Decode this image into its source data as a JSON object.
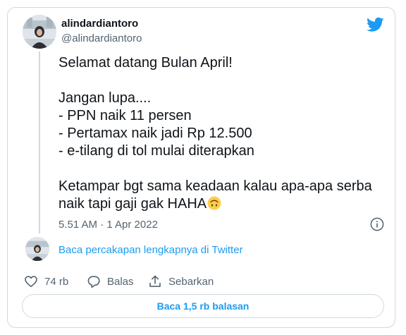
{
  "colors": {
    "accent": "#1d9bf0",
    "text_primary": "#0f1419",
    "text_secondary": "#536471",
    "border": "#cfd9de"
  },
  "tweet": {
    "display_name": "alindardiantoro",
    "handle": "@alindardiantoro",
    "text": "Selamat datang Bulan April!\n\nJangan lupa....\n- PPN naik 11 persen\n- Pertamax naik jadi Rp 12.500\n- e-tilang di tol mulai diterapkan\n\nKetampar bgt sama keadaan kalau apa-apa serba naik tapi gaji gak HAHA",
    "emoji": "upside-down-face-emoji",
    "timestamp": "5.51 AM · 1 Apr 2022",
    "icons": {
      "brand": "twitter-bird-icon",
      "info": "info-icon"
    }
  },
  "conversation": {
    "link_label": "Baca percakapan lengkapnya di Twitter"
  },
  "actions": {
    "like_count": "74 rb",
    "reply_label": "Balas",
    "share_label": "Sebarkan"
  },
  "replies_button": {
    "label": "Baca 1,5 rb balasan"
  }
}
